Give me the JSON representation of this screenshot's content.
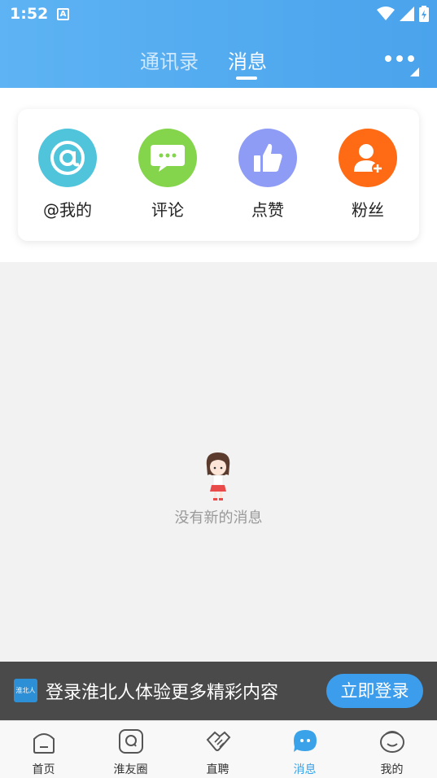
{
  "status_bar": {
    "time": "1:52",
    "notification_letter": "A"
  },
  "header": {
    "tabs": [
      {
        "label": "通讯录",
        "active": false
      },
      {
        "label": "消息",
        "active": true
      }
    ]
  },
  "categories": [
    {
      "label": "@我的",
      "icon": "at-icon",
      "color": "#4fc4db"
    },
    {
      "label": "评论",
      "icon": "comment-icon",
      "color": "#84d44c"
    },
    {
      "label": "点赞",
      "icon": "thumbs-up-icon",
      "color": "#8e9cf6"
    },
    {
      "label": "粉丝",
      "icon": "fans-icon",
      "color": "#ff6a14"
    }
  ],
  "empty_state": {
    "text": "没有新的消息"
  },
  "login_banner": {
    "logo_text": "淮北人",
    "message": "登录淮北人体验更多精彩内容",
    "button": "立即登录"
  },
  "bottom_nav": [
    {
      "label": "首页",
      "icon": "home-icon",
      "active": false
    },
    {
      "label": "淮友圈",
      "icon": "circle-icon",
      "active": false
    },
    {
      "label": "直聘",
      "icon": "handshake-icon",
      "active": false
    },
    {
      "label": "消息",
      "icon": "message-icon",
      "active": true
    },
    {
      "label": "我的",
      "icon": "profile-icon",
      "active": false
    }
  ],
  "colors": {
    "accent": "#3aa2e8",
    "header": "#4aa3ec"
  }
}
